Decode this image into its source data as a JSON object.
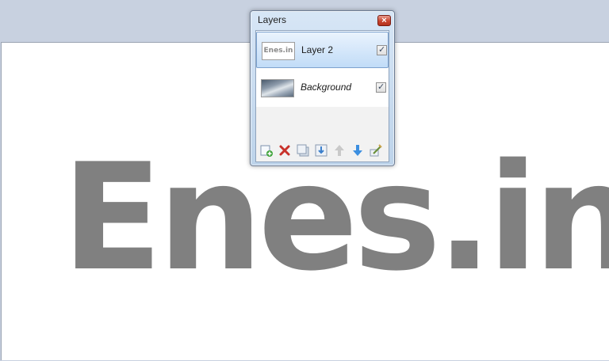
{
  "canvas": {
    "text": "Enes.in",
    "text_color": "#808080"
  },
  "layers_window": {
    "title": "Layers",
    "close_label": "×",
    "layers": [
      {
        "name": "Layer 2",
        "thumbnail_text": "Enes.in",
        "visible": true,
        "selected": true,
        "italic": false
      },
      {
        "name": "Background",
        "thumbnail_text": "",
        "visible": true,
        "selected": false,
        "italic": true
      }
    ],
    "toolbar": [
      {
        "icon": "add-layer-icon"
      },
      {
        "icon": "delete-layer-icon"
      },
      {
        "icon": "duplicate-layer-icon"
      },
      {
        "icon": "merge-layer-down-icon"
      },
      {
        "icon": "move-layer-up-icon"
      },
      {
        "icon": "move-layer-down-icon"
      },
      {
        "icon": "layer-properties-icon"
      }
    ]
  },
  "colors": {
    "background": "#c8d1e0",
    "selection": "#c1dcf7",
    "close_button": "#c9452f"
  }
}
